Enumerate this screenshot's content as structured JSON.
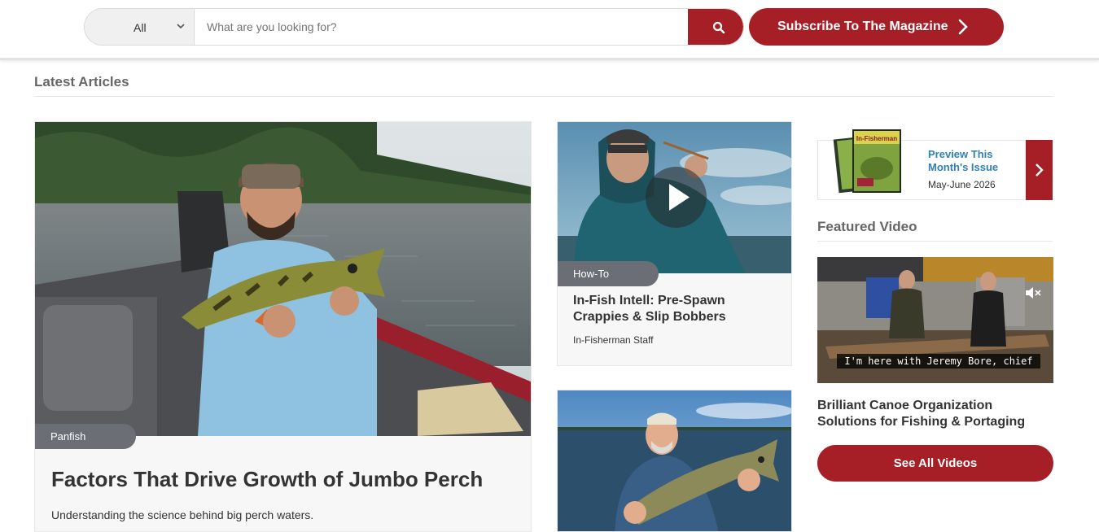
{
  "header": {
    "search_category": "All",
    "search_placeholder": "What are you looking for?",
    "subscribe_label": "Subscribe To The Magazine"
  },
  "section": {
    "title": "Latest Articles"
  },
  "main_article": {
    "tag": "Panfish",
    "title": "Factors That Drive Growth of Jumbo Perch",
    "description": "Understanding the science behind big perch waters."
  },
  "articles": [
    {
      "tag": "How-To",
      "title": "In-Fish Intell: Pre-Spawn Crappies & Slip Bobbers",
      "author": "In-Fisherman Staff"
    },
    {
      "tag": "",
      "title": "",
      "author": ""
    }
  ],
  "magazine": {
    "preview_label": "Preview This Month's Issue",
    "issue_date": "May-June 2026",
    "cover_text": "In-Fisherman"
  },
  "featured_video": {
    "section_title": "Featured Video",
    "caption": "I'm here with Jeremy Bore, chief",
    "title": "Brilliant Canoe Organization Solutions for Fishing & Portaging",
    "see_all_label": "See All Videos"
  },
  "colors": {
    "brand_red": "#a61f26",
    "tag_gray": "#6b6e75",
    "link_blue": "#2f80b5"
  }
}
